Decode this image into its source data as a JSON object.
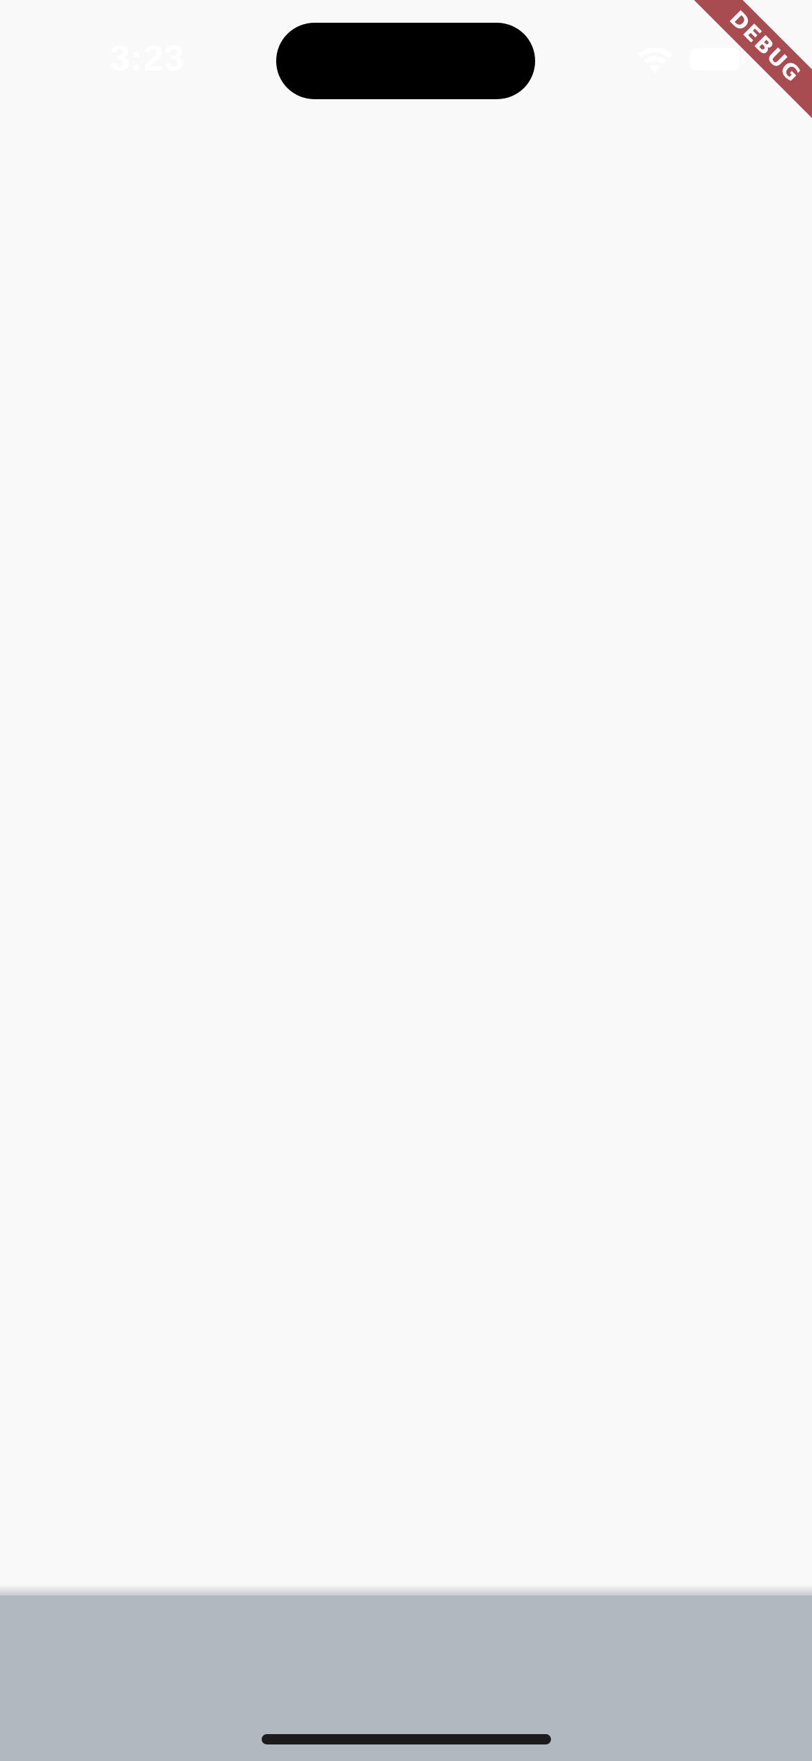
{
  "status_bar": {
    "time": "3:23",
    "wifi_icon": "wifi-icon",
    "battery_icon": "battery-icon"
  },
  "debug_banner": {
    "label": "DEBUG",
    "color": "#a33f46"
  },
  "colors": {
    "background": "#f9f9f9",
    "bottom_bar": "#b2b8c0",
    "home_indicator": "#1c1c1e"
  }
}
